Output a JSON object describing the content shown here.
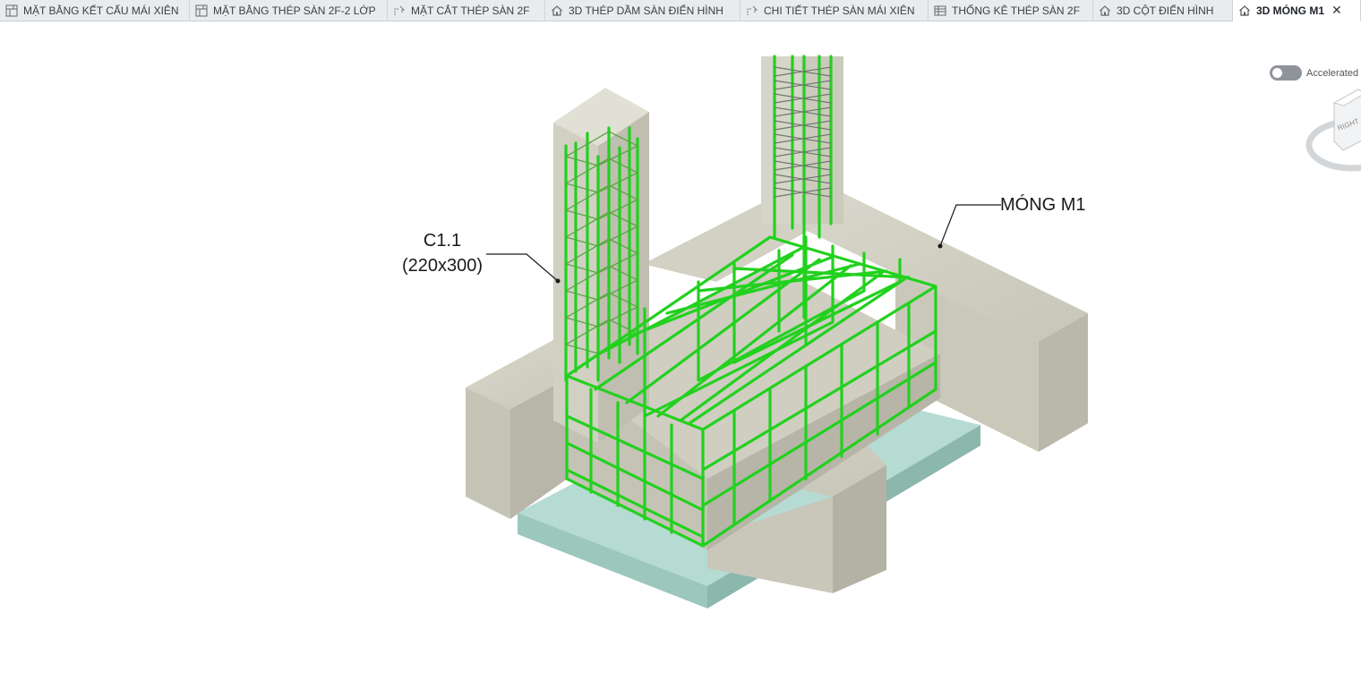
{
  "tabs": [
    {
      "label": "MẶT BẰNG KẾT CẤU MÁI XIÊN",
      "icon": "floor-plan-icon"
    },
    {
      "label": "MẶT BẰNG THÉP SÀN 2F-2 LỚP",
      "icon": "floor-plan-icon"
    },
    {
      "label": "MẶT CẮT THÉP SÀN 2F",
      "icon": "section-view-icon"
    },
    {
      "label": "3D THÉP DẦM SÀN ĐIỂN HÌNH",
      "icon": "house-3d-icon"
    },
    {
      "label": "CHI TIẾT THÉP SÀN MÁI XIÊN",
      "icon": "section-view-icon"
    },
    {
      "label": "THỐNG KÊ THÉP SÀN 2F",
      "icon": "schedule-icon"
    },
    {
      "label": "3D CỘT ĐIỂN HÌNH",
      "icon": "house-3d-icon"
    },
    {
      "label": "3D MÓNG M1",
      "icon": "house-3d-icon",
      "active": true
    }
  ],
  "close_symbol": "✕",
  "accelerated": {
    "label": "Accelerated"
  },
  "viewcube": {
    "face_label": "RIGHT"
  },
  "annotations": {
    "column_name": "C1.1",
    "column_size": "(220x300)",
    "footing_name": "MÓNG M1"
  },
  "colors": {
    "rebar": "#22d11e",
    "concrete": "#cfcfc2",
    "lean_concrete": "#a9d6cc"
  }
}
